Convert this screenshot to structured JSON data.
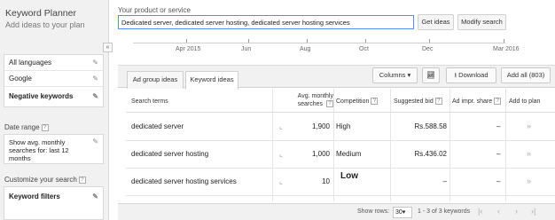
{
  "app": {
    "title": "Keyword Planner",
    "subtitle": "Add ideas to your plan"
  },
  "search": {
    "label": "Your product or service",
    "value": "Dedicated server, dedicated server hosting, dedicated server hosting services",
    "get_ideas": "Get ideas",
    "modify_search": "Modify search"
  },
  "timeline": {
    "labels": [
      "Apr 2015",
      "Jun",
      "Aug",
      "Oct",
      "Dec",
      "Mar 2016"
    ]
  },
  "sidebar": {
    "collapse": "«",
    "targeting": [
      "All languages",
      "Google",
      "Negative keywords"
    ],
    "date_range_label": "Date range",
    "date_range_value": "Show avg. monthly searches for: last 12 months",
    "customize_label": "Customize your search",
    "keyword_filters": "Keyword filters"
  },
  "tabs": {
    "ad_group_ideas": "Ad group ideas",
    "keyword_ideas": "Keyword ideas"
  },
  "toolbar": {
    "columns": "Columns",
    "download": "Download",
    "add_all": "Add all (803)"
  },
  "table": {
    "headers": {
      "search_terms": "Search terms",
      "avg_monthly": "Avg. monthly searches",
      "competition": "Competition",
      "suggested_bid": "Suggested bid",
      "ad_impr_share": "Ad impr. share",
      "add_to_plan": "Add to plan"
    },
    "rows": [
      {
        "term": "dedicated server",
        "searches": "1,900",
        "competition": "High",
        "bid": "Rs.588.58",
        "share": "–"
      },
      {
        "term": "dedicated server hosting",
        "searches": "1,000",
        "competition": "Medium",
        "bid": "Rs.436.02",
        "share": "–"
      },
      {
        "term": "dedicated server hosting services",
        "searches": "10",
        "competition": "Low",
        "bid": "–",
        "share": "–"
      }
    ]
  },
  "footer": {
    "show_rows_label": "Show rows:",
    "rows_value": "30",
    "range": "1 - 3 of 3 keywords"
  },
  "colors": {
    "input_border": "#4d90fe",
    "panel_bg": "#f1f1f1"
  }
}
